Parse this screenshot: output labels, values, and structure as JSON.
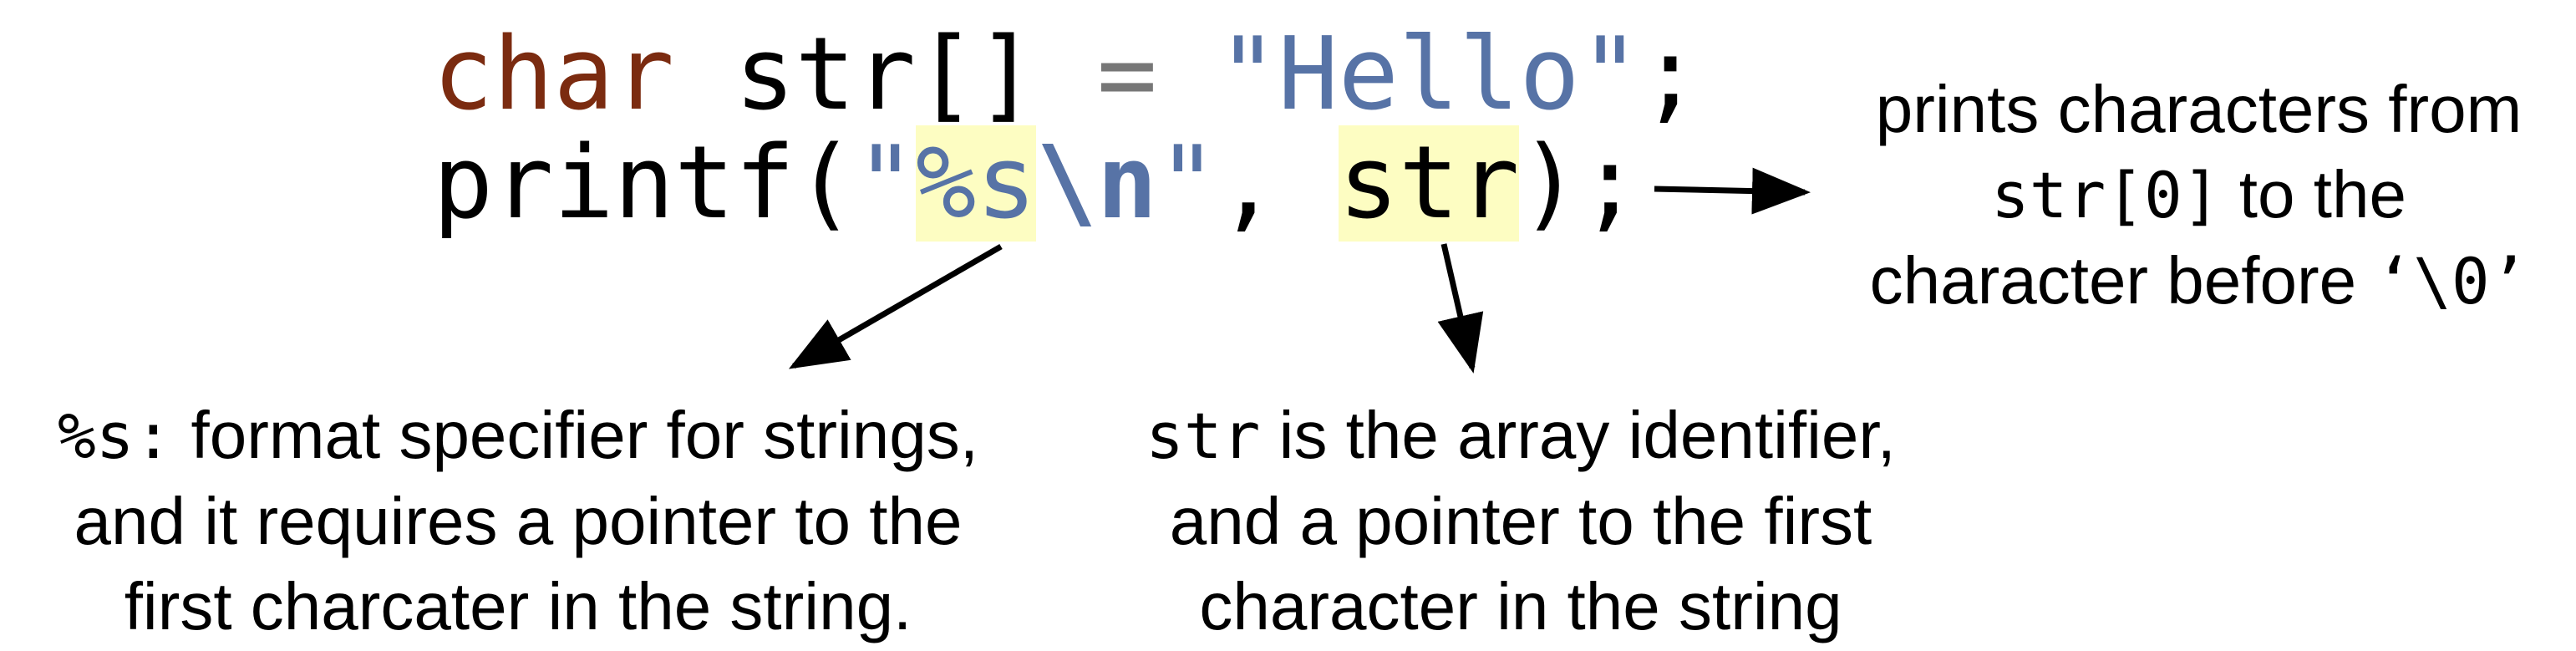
{
  "colors": {
    "keyword": "#7b2b10",
    "string_literal": "#5773a6",
    "operator": "#777777",
    "highlight": "#fdfdc2",
    "text": "#000000"
  },
  "code": {
    "line1": {
      "keyword": "char",
      "declarator": " str[] ",
      "operator": "=",
      "space": " ",
      "string": "\"Hello\"",
      "terminator": ";"
    },
    "line2": {
      "func_open": "printf(",
      "quote_open": "\"",
      "format_spec": "%s",
      "escape": "\\n",
      "quote_close": "\"",
      "comma": ", ",
      "argument": "str",
      "close": ");"
    }
  },
  "annotations": {
    "right": {
      "line1": "prints characters from",
      "line2_code": "str[0]",
      "line2_text": " to the",
      "line3_text": "character before ",
      "line3_code": "‘\\0’"
    },
    "format_specifier": {
      "code": "%s:",
      "line1_text": " format specifier for strings,",
      "line2": "and it requires a pointer to the",
      "line3": "first charcater in the string."
    },
    "array_identifier": {
      "code": "str",
      "line1_text": " is the array identifier,",
      "line2": "and a pointer to the first",
      "line3": "character in the string"
    }
  }
}
